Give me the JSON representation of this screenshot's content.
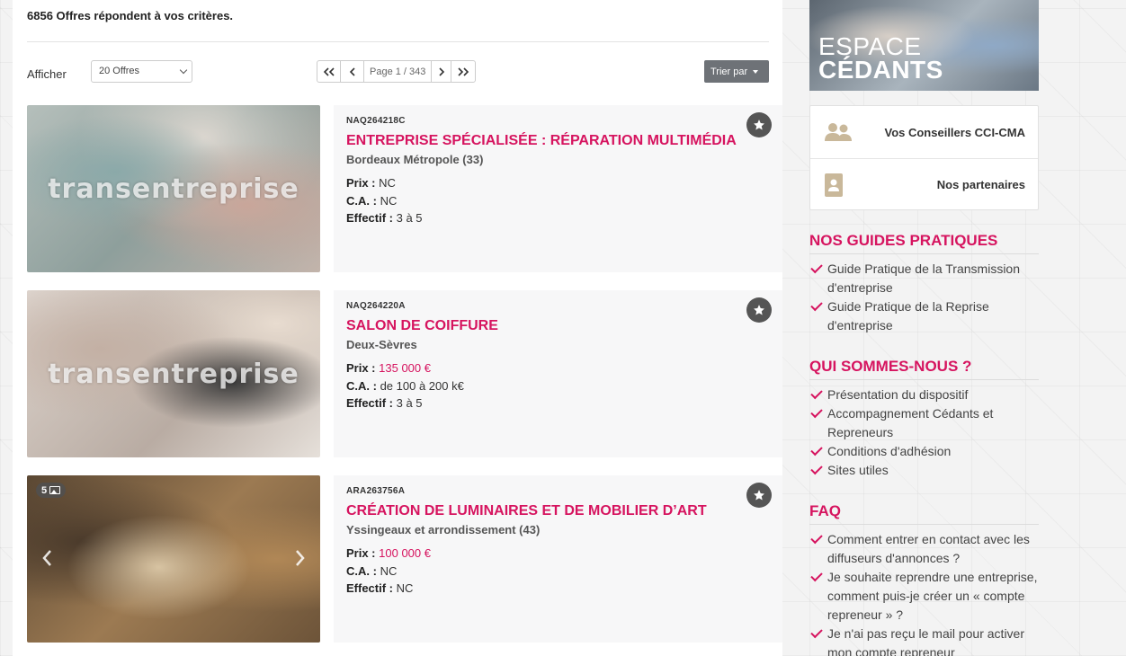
{
  "results": {
    "count_text": "6856 Offres répondent à vos critères."
  },
  "toolbar": {
    "show_label": "Afficher",
    "per_page_value": "20 Offres",
    "page_label": "Page 1 / 343",
    "first_glyph": "«",
    "prev_glyph": "‹",
    "next_glyph": "›",
    "last_glyph": "»",
    "sort_label": "Trier par"
  },
  "listings": [
    {
      "ref": "NAQ264218C",
      "title": "ENTREPRISE SPÉCIALISÉE : RÉPARATION MULTIMÉDIA",
      "location": "Bordeaux Métropole (33)",
      "price_label": "Prix :",
      "price": "NC",
      "ca_label": "C.A. :",
      "ca": "NC",
      "staff_label": "Effectif :",
      "staff": "3 à 5",
      "watermark": "transentreprise"
    },
    {
      "ref": "NAQ264220A",
      "title": "SALON DE COIFFURE",
      "location": "Deux-Sèvres",
      "price_label": "Prix :",
      "price": "135 000 €",
      "ca_label": "C.A. :",
      "ca": "de 100 à 200 k€",
      "staff_label": "Effectif :",
      "staff": "3 à 5",
      "watermark": "transentreprise"
    },
    {
      "ref": "ARA263756A",
      "title": "CRÉATION DE LUMINAIRES ET DE MOBILIER D’ART",
      "location": "Yssingeaux et arrondissement (43)",
      "price_label": "Prix :",
      "price": "100 000 €",
      "ca_label": "C.A. :",
      "ca": "NC",
      "staff_label": "Effectif :",
      "staff": "NC",
      "photo_count": "5"
    }
  ],
  "sidebar": {
    "banner_line1": "ESPACE",
    "banner_line2": "CÉDANTS",
    "links": [
      {
        "label": "Vos Conseillers CCI-CMA",
        "icon": "users-icon"
      },
      {
        "label": "Nos partenaires",
        "icon": "address-book-icon"
      }
    ],
    "sections": [
      {
        "title": "NOS GUIDES PRATIQUES",
        "items": [
          "Guide Pratique de la Transmission d'entreprise",
          "Guide Pratique de la Reprise d'entreprise"
        ]
      },
      {
        "title": "QUI SOMMES-NOUS ?",
        "items": [
          "Présentation du dispositif",
          "Accompagnement Cédants et Repreneurs",
          "Conditions d'adhésion",
          "Sites utiles"
        ]
      },
      {
        "title": "FAQ",
        "items": [
          "Comment entrer en contact avec les diffuseurs d'annonces ?",
          "Je souhaite reprendre une entreprise, comment puis-je créer un « compte repreneur » ?",
          "Je n'ai pas reçu le mail pour activer mon compte repreneur"
        ]
      }
    ]
  },
  "colors": {
    "accent": "#d6145f",
    "button_grey": "#6e7277",
    "card_bg": "#f7f7f8"
  }
}
